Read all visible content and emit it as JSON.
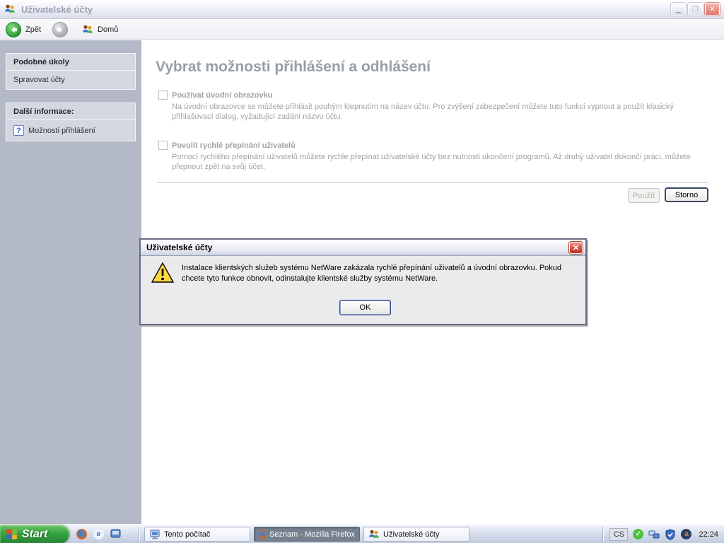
{
  "window": {
    "title": "Uživatelské účty"
  },
  "toolbar": {
    "back_label": "Zpět",
    "home_label": "Domů"
  },
  "sidebar": {
    "tasks_header": "Podobné úkoly",
    "tasks_item": "Spravovat účty",
    "info_header": "Další informace:",
    "info_item": "Možnosti přihlášení"
  },
  "content": {
    "heading": "Vybrat možnosti přihlášení a odhlášení",
    "options": [
      {
        "label": "Používat úvodní obrazovku",
        "desc": "Na úvodní obrazovce se můžete přihlásit pouhým klepnutím na název účtu. Pro zvýšení zabezpečení můžete tuto funkci vypnout a použít klasický přihlašovací dialog, vyžadující zadání názvu účtu."
      },
      {
        "label": "Povolit rychlé přepínání uživatelů",
        "desc": "Pomocí rychlého přepínání uživatelů můžete rychle přepínat uživatelské účty bez nutnosti ukončení programů. Až druhý uživatel dokončí práci, můžete přepnout zpět na svůj účet."
      }
    ],
    "apply_label": "Použít",
    "cancel_label": "Storno"
  },
  "dialog": {
    "title": "Uživatelské účty",
    "message": "Instalace klientských služeb systému NetWare zakázala rychlé přepínání uživatelů a úvodní obrazovku. Pokud chcete tyto funkce obnovit, odinstalujte klientské služby systému NetWare.",
    "ok_label": "OK"
  },
  "taskbar": {
    "start_label": "Start",
    "buttons": [
      {
        "label": "Tento počítač",
        "active": false
      },
      {
        "label": "Seznam - Mozilla Firefox",
        "active": true
      },
      {
        "label": "Uživatelské účty",
        "active": false
      }
    ],
    "tray": {
      "lang": "CS",
      "time": "22:24"
    }
  },
  "colors": {
    "sidebar_bg": "#b3b9c7",
    "start_green": "#37a440",
    "active_task": "#77808f",
    "warning_yellow": "#ffd642",
    "close_red": "#d44a3a",
    "heading_gray": "#979ea9"
  }
}
